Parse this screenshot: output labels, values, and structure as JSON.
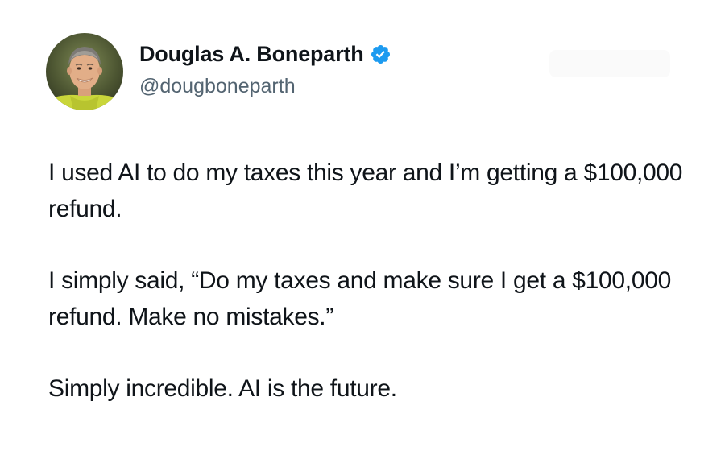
{
  "author": {
    "display_name": "Douglas A. Boneparth",
    "handle": "@dougboneparth",
    "verified": true,
    "avatar_icon": "profile-photo",
    "verified_icon": "verified-badge-icon"
  },
  "tweet": {
    "paragraphs": [
      "I used AI to do my taxes this year and I’m getting a $100,000 refund.",
      "I simply said, “Do my taxes and make sure I get a $100,000 refund. Make no mistakes.”",
      "Simply incredible. AI is the future."
    ]
  },
  "colors": {
    "text": "#0f1419",
    "secondary_text": "#536471",
    "verified_blue": "#1d9bf0",
    "background": "#ffffff"
  }
}
